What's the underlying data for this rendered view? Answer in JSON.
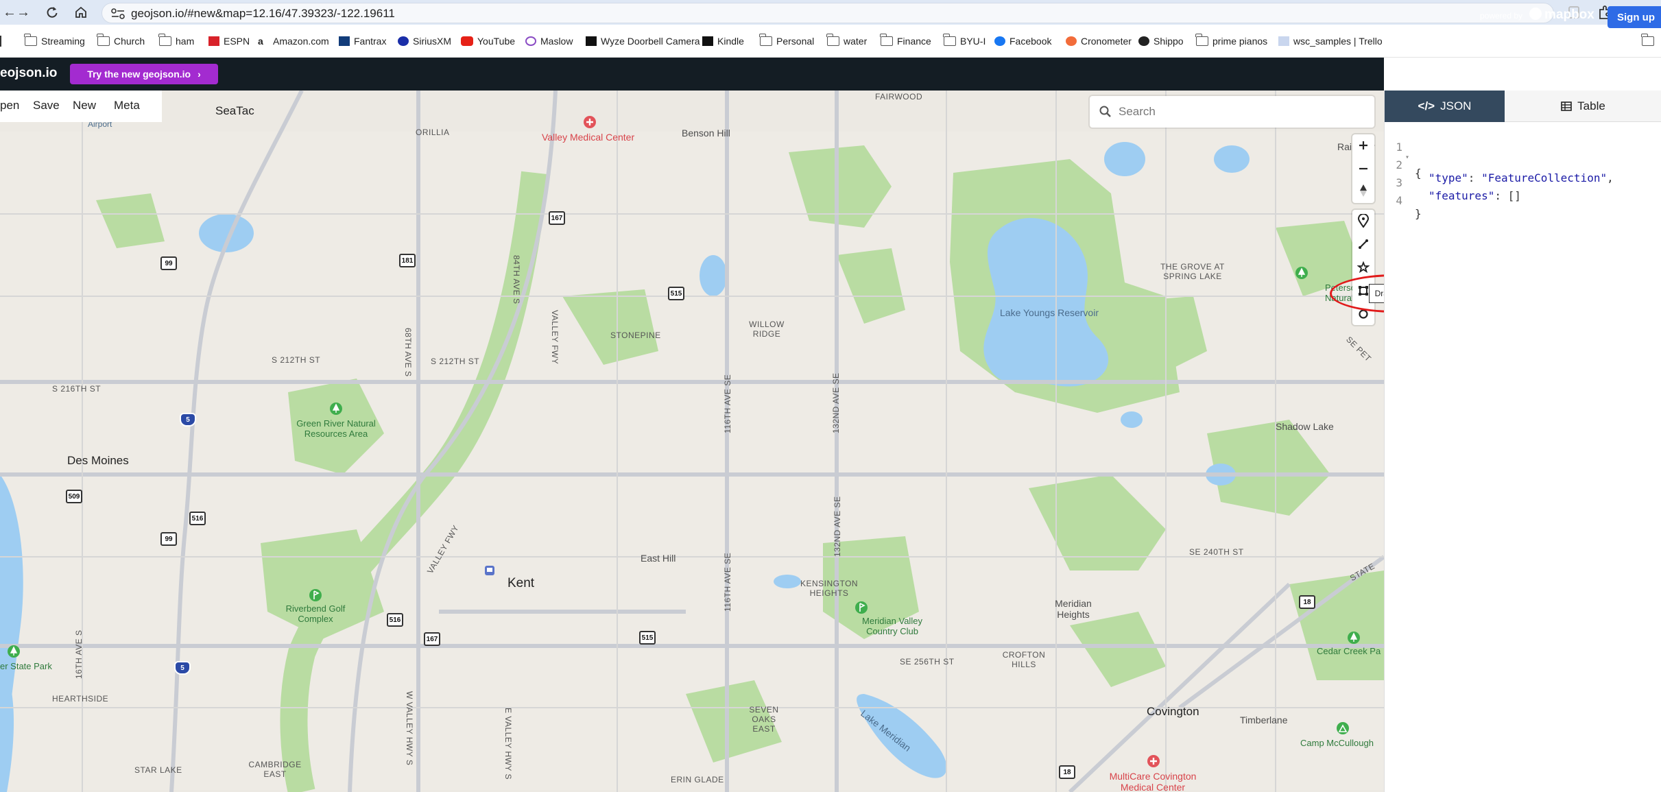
{
  "browser": {
    "url": "geojson.io/#new&map=12.16/47.39323/-122.19611",
    "bookmarks": [
      "Streaming",
      "Church",
      "ham",
      "ESPN",
      "Amazon.com",
      "Fantrax",
      "SiriusXM",
      "YouTube",
      "Maslow",
      "Wyze Doorbell Camera",
      "Kindle",
      "Personal",
      "water",
      "Finance",
      "BYU-I",
      "Facebook",
      "Cronometer",
      "Shippo",
      "prime pianos",
      "wsc_samples | Trello"
    ]
  },
  "header": {
    "brand": "eojson.io",
    "try_new": "Try the new geojson.io",
    "powered_by": "powered by",
    "mapbox": "mapbox",
    "signup": "Sign up"
  },
  "menu": {
    "open": "pen",
    "save": "Save",
    "new": "New",
    "meta": "Meta"
  },
  "search": {
    "placeholder": "Search"
  },
  "tooltip": "Draw Polygon (p)",
  "tabs": {
    "json": "JSON",
    "table": "Table"
  },
  "code_lines": [
    {
      "n": "1",
      "text": "{"
    },
    {
      "n": "2",
      "key": "\"type\"",
      "value": "\"FeatureCollection\"",
      "tail": ","
    },
    {
      "n": "3",
      "key": "\"features\"",
      "value": "[]",
      "tail": ""
    },
    {
      "n": "4",
      "text": "}"
    }
  ],
  "map_labels": {
    "seatac": "SeaTac",
    "airport": "Airport",
    "orillia": "ORILLIA",
    "valley_medical": "Valley Medical Center",
    "benson_hill": "Benson Hill",
    "fairwood": "FAIRWOOD",
    "rainbow": "Rainbow",
    "s212": "S 212TH ST",
    "s212b": "S 212TH ST",
    "s216": "S 216TH ST",
    "des_moines": "Des Moines",
    "green_river": "Green River Natural Resources Area",
    "stonepine": "STONEPINE",
    "willow_ridge": "WILLOW RIDGE",
    "lake_youngs": "Lake Youngs Reservoir",
    "grove": "THE GROVE AT SPRING LAKE",
    "peterson": "Peterson Lake Natural Area",
    "shadow_lake": "Shadow Lake",
    "se240": "SE 240TH ST",
    "east_hill": "East Hill",
    "kent": "Kent",
    "kensington": "KENSINGTON HEIGHTS",
    "meridian_valley": "Meridian Valley Country Club",
    "meridian_heights": "Meridian Heights",
    "riverbend": "Riverbend Golf Complex",
    "crofton": "CROFTON HILLS",
    "se256": "SE 256TH ST",
    "cedar_creek": "Cedar Creek Pa",
    "state_park": "er State Park",
    "hearthside": "HEARTHSIDE",
    "seven_oaks": "SEVEN OAKS EAST",
    "lake_meridian": "Lake Meridian",
    "covington": "Covington",
    "timberlane": "Timberlane",
    "camp_mccullough": "Camp McCullough",
    "multicare": "MultiCare Covington Medical Center",
    "star_lake": "STAR LAKE",
    "cambridge": "CAMBRIDGE EAST",
    "erin_glade": "ERIN GLADE",
    "ave84": "84TH AVE S",
    "ave68": "68TH AVE S",
    "valley_fwy": "VALLEY FWY",
    "valley_fwy2": "VALLEY FWY",
    "ave116": "116TH AVE SE",
    "ave116b": "116TH AVE SE",
    "ave132": "132ND AVE SE",
    "ave132b": "132ND AVE SE",
    "ave16": "16TH AVE S",
    "w_valley": "W VALLEY HWY S",
    "e_valley": "E VALLEY HWY S",
    "se_pet": "SE PET",
    "state": "STATE",
    "r99a": "99",
    "r181": "181",
    "r167a": "167",
    "r515a": "515",
    "r5a": "5",
    "r509": "509",
    "r516a": "516",
    "r99b": "99",
    "r516b": "516",
    "r167b": "167",
    "r515b": "515",
    "r5b": "5",
    "r18a": "18",
    "r18b": "18"
  },
  "colors": {
    "header_bg": "#141d24",
    "try_new": "#a32bd0",
    "signup": "#2e6be6",
    "json_tab": "#34495e",
    "map_bg": "#ece9e3",
    "park": "#b9dca2",
    "water": "#9ecdf2",
    "highlight": "#e11a1a"
  }
}
